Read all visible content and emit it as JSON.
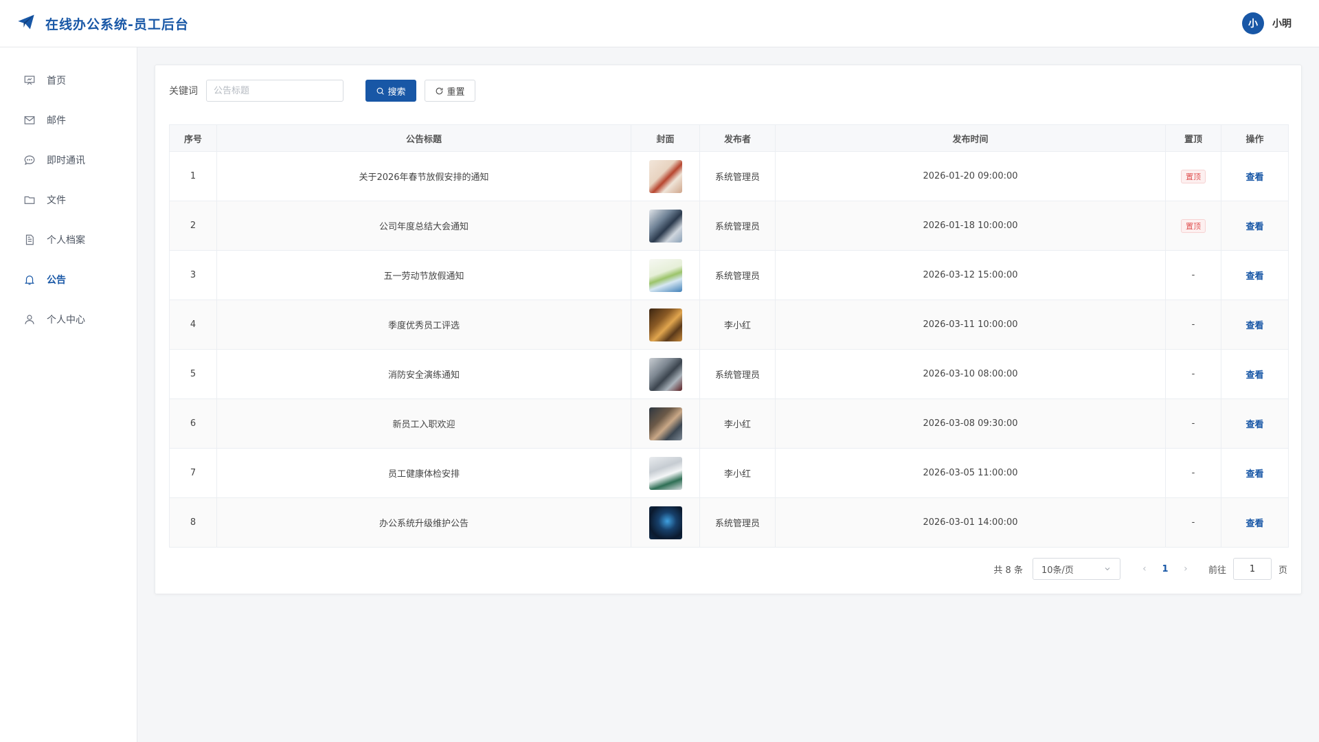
{
  "header": {
    "title": "在线办公系统-员工后台",
    "user_avatar_text": "小",
    "user_name": "小明"
  },
  "sidebar": {
    "items": [
      {
        "label": "首页",
        "icon": "presentation-icon"
      },
      {
        "label": "邮件",
        "icon": "mail-icon"
      },
      {
        "label": "即时通讯",
        "icon": "chat-icon"
      },
      {
        "label": "文件",
        "icon": "folder-icon"
      },
      {
        "label": "个人档案",
        "icon": "document-icon"
      },
      {
        "label": "公告",
        "icon": "bell-icon",
        "active": true
      },
      {
        "label": "个人中心",
        "icon": "user-icon"
      }
    ]
  },
  "search": {
    "label": "关键词",
    "value": "",
    "placeholder": "公告标题",
    "search_label": "搜索",
    "reset_label": "重置"
  },
  "table": {
    "columns": [
      "序号",
      "公告标题",
      "封面",
      "发布者",
      "发布时间",
      "置顶",
      "操作"
    ],
    "rows": [
      {
        "no": "1",
        "title": "关于2026年春节放假安排的通知",
        "publisher": "系统管理员",
        "time": "2026-01-20 09:00:00",
        "pinned": "置顶",
        "action": "查看"
      },
      {
        "no": "2",
        "title": "公司年度总结大会通知",
        "publisher": "系统管理员",
        "time": "2026-01-18 10:00:00",
        "pinned": "置顶",
        "action": "查看"
      },
      {
        "no": "3",
        "title": "五一劳动节放假通知",
        "publisher": "系统管理员",
        "time": "2026-03-12 15:00:00",
        "pinned": "-",
        "action": "查看"
      },
      {
        "no": "4",
        "title": "季度优秀员工评选",
        "publisher": "李小红",
        "time": "2026-03-11 10:00:00",
        "pinned": "-",
        "action": "查看"
      },
      {
        "no": "5",
        "title": "消防安全演练通知",
        "publisher": "系统管理员",
        "time": "2026-03-10 08:00:00",
        "pinned": "-",
        "action": "查看"
      },
      {
        "no": "6",
        "title": "新员工入职欢迎",
        "publisher": "李小红",
        "time": "2026-03-08 09:30:00",
        "pinned": "-",
        "action": "查看"
      },
      {
        "no": "7",
        "title": "员工健康体检安排",
        "publisher": "李小红",
        "time": "2026-03-05 11:00:00",
        "pinned": "-",
        "action": "查看"
      },
      {
        "no": "8",
        "title": "办公系统升级维护公告",
        "publisher": "系统管理员",
        "time": "2026-03-01 14:00:00",
        "pinned": "-",
        "action": "查看"
      }
    ]
  },
  "pagination": {
    "total_text": "共 8 条",
    "page_size": "10条/页",
    "prev": "‹",
    "current_page": "1",
    "next": "›",
    "goto_label": "前往",
    "goto_value": "1",
    "page_suffix": "页"
  },
  "colors": {
    "primary": "#1857a6",
    "pinned_tag": "#e05252"
  }
}
